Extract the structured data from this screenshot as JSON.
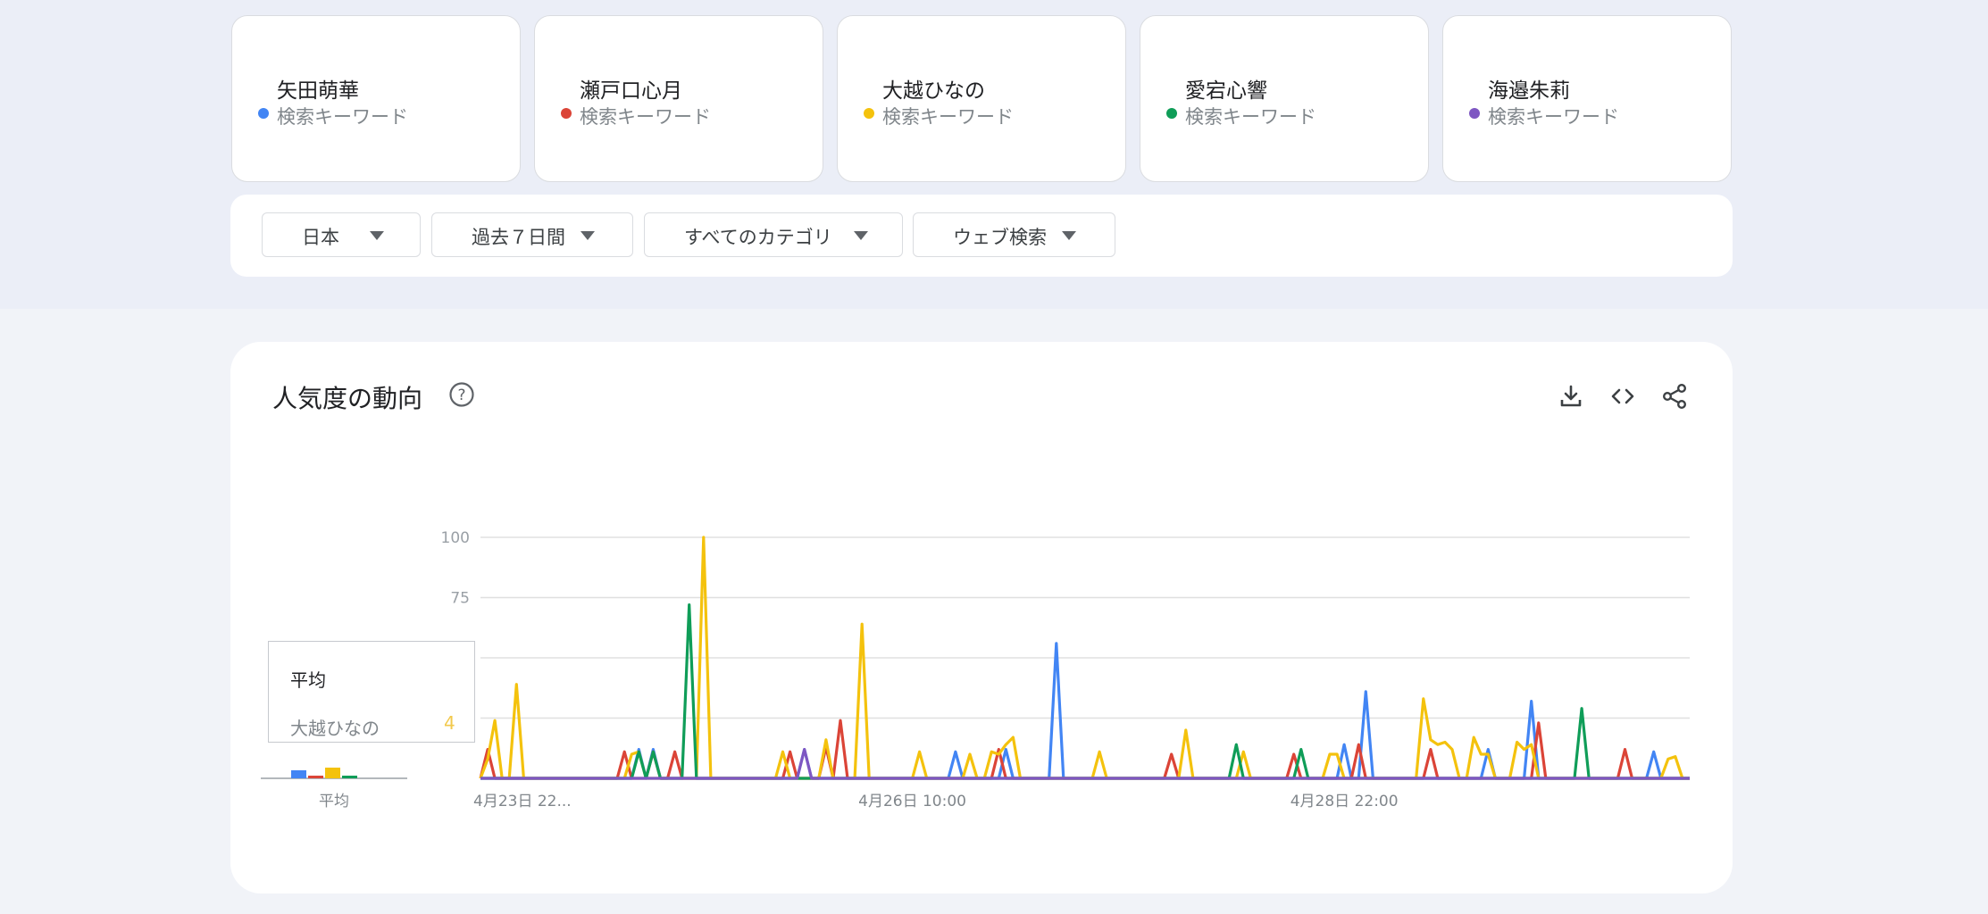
{
  "keywords": [
    {
      "name": "矢田萌華",
      "type": "検索キーワード",
      "color": "#4285f4"
    },
    {
      "name": "瀬戸口心月",
      "type": "検索キーワード",
      "color": "#db4437"
    },
    {
      "name": "大越ひなの",
      "type": "検索キーワード",
      "color": "#f4c20d"
    },
    {
      "name": "愛宕心響",
      "type": "検索キーワード",
      "color": "#0f9d58"
    },
    {
      "name": "海邉朱莉",
      "type": "検索キーワード",
      "color": "#7e57c2"
    }
  ],
  "filters": {
    "region": "日本",
    "period": "過去７日間",
    "category": "すべてのカテゴリ",
    "search_type": "ウェブ検索"
  },
  "panel": {
    "title": "人気度の動向",
    "help_icon": "help-circle-icon",
    "download_icon": "download-icon",
    "embed_icon": "code-icon",
    "share_icon": "share-icon"
  },
  "tooltip": {
    "title": "平均",
    "name": "大越ひなの",
    "value": "4"
  },
  "chart_data": {
    "type": "line",
    "title": "",
    "ylim": [
      0,
      100
    ],
    "y_ticks": [
      {
        "value": 100,
        "label": "100"
      },
      {
        "value": 75,
        "label": "75"
      },
      {
        "value": 50,
        "label": ""
      },
      {
        "value": 25,
        "label": ""
      },
      {
        "value": 0,
        "label": ""
      }
    ],
    "x_tick_labels": [
      "4月23日 22...",
      "4月26日 10:00",
      "4月28日 22:00"
    ],
    "x_tick_index": [
      0,
      60,
      120
    ],
    "n_points": 169,
    "average": {
      "label": "平均",
      "values": [
        3,
        1,
        4,
        1,
        0
      ]
    },
    "series": [
      {
        "name": "矢田萌華",
        "color": "#4285f4",
        "points": [
          [
            0,
            0
          ],
          [
            21,
            0
          ],
          [
            22,
            12
          ],
          [
            23,
            0
          ],
          [
            24,
            12
          ],
          [
            25,
            0
          ],
          [
            44,
            0
          ],
          [
            45,
            12
          ],
          [
            46,
            0
          ],
          [
            65,
            0
          ],
          [
            66,
            11
          ],
          [
            67,
            0
          ],
          [
            72,
            0
          ],
          [
            73,
            12
          ],
          [
            74,
            0
          ],
          [
            79,
            0
          ],
          [
            80,
            56
          ],
          [
            81,
            0
          ],
          [
            119,
            0
          ],
          [
            120,
            14
          ],
          [
            121,
            0
          ],
          [
            122,
            0
          ],
          [
            123,
            36
          ],
          [
            124,
            0
          ],
          [
            139,
            0
          ],
          [
            140,
            12
          ],
          [
            141,
            0
          ],
          [
            145,
            0
          ],
          [
            146,
            32
          ],
          [
            147,
            0
          ],
          [
            162,
            0
          ],
          [
            163,
            11
          ],
          [
            164,
            0
          ],
          [
            168,
            0
          ]
        ]
      },
      {
        "name": "瀬戸口心月",
        "color": "#db4437",
        "points": [
          [
            0,
            0
          ],
          [
            1,
            12
          ],
          [
            2,
            0
          ],
          [
            19,
            0
          ],
          [
            20,
            11
          ],
          [
            21,
            0
          ],
          [
            23,
            0
          ],
          [
            24,
            11
          ],
          [
            25,
            0
          ],
          [
            26,
            0
          ],
          [
            27,
            11
          ],
          [
            28,
            0
          ],
          [
            42,
            0
          ],
          [
            43,
            11
          ],
          [
            44,
            0
          ],
          [
            47,
            0
          ],
          [
            48,
            13
          ],
          [
            49,
            0
          ],
          [
            50,
            24
          ],
          [
            51,
            0
          ],
          [
            71,
            0
          ],
          [
            72,
            12
          ],
          [
            73,
            0
          ],
          [
            95,
            0
          ],
          [
            96,
            10
          ],
          [
            97,
            0
          ],
          [
            112,
            0
          ],
          [
            113,
            10
          ],
          [
            114,
            0
          ],
          [
            121,
            0
          ],
          [
            122,
            14
          ],
          [
            123,
            0
          ],
          [
            131,
            0
          ],
          [
            132,
            12
          ],
          [
            133,
            0
          ],
          [
            146,
            0
          ],
          [
            147,
            23
          ],
          [
            148,
            0
          ],
          [
            158,
            0
          ],
          [
            159,
            12
          ],
          [
            160,
            0
          ],
          [
            168,
            0
          ]
        ]
      },
      {
        "name": "大越ひなの",
        "color": "#f4c20d",
        "points": [
          [
            0,
            0
          ],
          [
            1,
            8
          ],
          [
            2,
            24
          ],
          [
            3,
            0
          ],
          [
            4,
            0
          ],
          [
            5,
            39
          ],
          [
            6,
            0
          ],
          [
            20,
            0
          ],
          [
            21,
            10
          ],
          [
            22,
            11
          ],
          [
            23,
            0
          ],
          [
            30,
            0
          ],
          [
            31,
            100
          ],
          [
            32,
            0
          ],
          [
            41,
            0
          ],
          [
            42,
            11
          ],
          [
            43,
            0
          ],
          [
            47,
            0
          ],
          [
            48,
            16
          ],
          [
            49,
            0
          ],
          [
            52,
            0
          ],
          [
            53,
            64
          ],
          [
            54,
            0
          ],
          [
            60,
            0
          ],
          [
            61,
            11
          ],
          [
            62,
            0
          ],
          [
            67,
            0
          ],
          [
            68,
            10
          ],
          [
            69,
            0
          ],
          [
            70,
            0
          ],
          [
            71,
            11
          ],
          [
            72,
            10
          ],
          [
            73,
            14
          ],
          [
            74,
            17
          ],
          [
            75,
            0
          ],
          [
            85,
            0
          ],
          [
            86,
            11
          ],
          [
            87,
            0
          ],
          [
            97,
            0
          ],
          [
            98,
            20
          ],
          [
            99,
            0
          ],
          [
            105,
            0
          ],
          [
            106,
            11
          ],
          [
            107,
            0
          ],
          [
            117,
            0
          ],
          [
            118,
            10
          ],
          [
            119,
            10
          ],
          [
            120,
            0
          ],
          [
            130,
            0
          ],
          [
            131,
            33
          ],
          [
            132,
            16
          ],
          [
            133,
            14
          ],
          [
            134,
            15
          ],
          [
            135,
            12
          ],
          [
            136,
            0
          ],
          [
            137,
            0
          ],
          [
            138,
            17
          ],
          [
            139,
            10
          ],
          [
            140,
            10
          ],
          [
            141,
            0
          ],
          [
            143,
            0
          ],
          [
            144,
            15
          ],
          [
            145,
            12
          ],
          [
            146,
            14
          ],
          [
            147,
            0
          ],
          [
            164,
            0
          ],
          [
            165,
            8
          ],
          [
            166,
            9
          ],
          [
            167,
            0
          ],
          [
            168,
            0
          ]
        ]
      },
      {
        "name": "愛宕心響",
        "color": "#0f9d58",
        "points": [
          [
            0,
            0
          ],
          [
            21,
            0
          ],
          [
            22,
            11
          ],
          [
            23,
            0
          ],
          [
            24,
            11
          ],
          [
            25,
            0
          ],
          [
            28,
            0
          ],
          [
            29,
            72
          ],
          [
            30,
            0
          ],
          [
            104,
            0
          ],
          [
            105,
            14
          ],
          [
            106,
            0
          ],
          [
            113,
            0
          ],
          [
            114,
            12
          ],
          [
            115,
            0
          ],
          [
            152,
            0
          ],
          [
            153,
            29
          ],
          [
            154,
            0
          ],
          [
            168,
            0
          ]
        ]
      },
      {
        "name": "海邉朱莉",
        "color": "#7e57c2",
        "points": [
          [
            0,
            0
          ],
          [
            44,
            0
          ],
          [
            45,
            12
          ],
          [
            46,
            0
          ],
          [
            168,
            0
          ]
        ]
      }
    ]
  }
}
